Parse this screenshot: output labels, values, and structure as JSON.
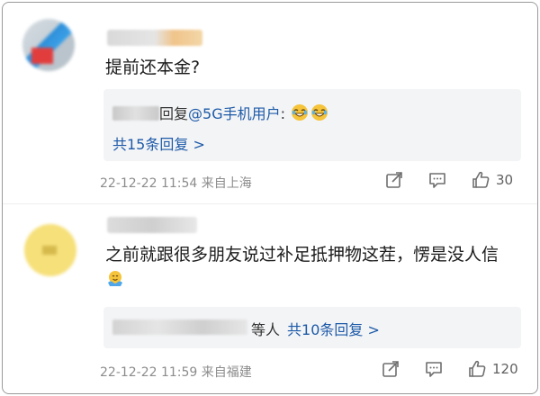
{
  "comments": [
    {
      "text": "提前还本金?",
      "reply": {
        "prefix": "回复",
        "mention": "@5G手机用户",
        "colon": ":",
        "count_label": "共15条回复 >"
      },
      "meta": "22-12-22 11:54 来自上海",
      "likes": "30"
    },
    {
      "text": "之前就跟很多朋友说过补足抵押物这茬，愣是没人信",
      "reply": {
        "suffix_text": "等人",
        "count_label": "共10条回复 >"
      },
      "meta": "22-12-22 11:59 来自福建",
      "likes": "120"
    }
  ],
  "colors": {
    "link": "#1d5aa8",
    "meta": "#8c8c8c",
    "reply_bg": "#f3f4f6"
  },
  "icons": [
    "share-icon",
    "comment-icon",
    "like-icon",
    "laugh-cry-emoji",
    "hug-emoji"
  ]
}
